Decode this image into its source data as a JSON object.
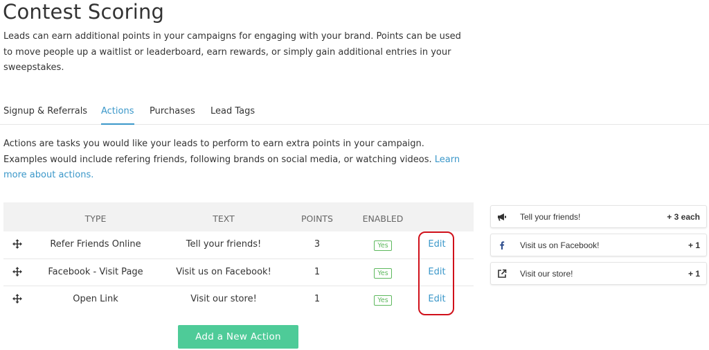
{
  "page": {
    "title": "Contest Scoring",
    "intro": "Leads can earn additional points in your campaigns for engaging with your brand. Points can be used to move people up a waitlist or leaderboard, earn rewards, or simply gain additional entries in your sweepstakes."
  },
  "tabs": [
    {
      "label": "Signup & Referrals",
      "active": false
    },
    {
      "label": "Actions",
      "active": true
    },
    {
      "label": "Purchases",
      "active": false
    },
    {
      "label": "Lead Tags",
      "active": false
    }
  ],
  "actions_description": {
    "text": "Actions are tasks you would like your leads to perform to earn extra points in your campaign. Examples would include refering friends, following brands on social media, or watching videos. ",
    "link": "Learn more about actions."
  },
  "table": {
    "headers": {
      "type": "TYPE",
      "text": "TEXT",
      "points": "POINTS",
      "enabled": "ENABLED"
    },
    "rows": [
      {
        "type": "Refer Friends Online",
        "text": "Tell your friends!",
        "points": "3",
        "enabled": "Yes",
        "edit": "Edit"
      },
      {
        "type": "Facebook - Visit Page",
        "text": "Visit us on Facebook!",
        "points": "1",
        "enabled": "Yes",
        "edit": "Edit"
      },
      {
        "type": "Open Link",
        "text": "Visit our store!",
        "points": "1",
        "enabled": "Yes",
        "edit": "Edit"
      }
    ]
  },
  "add_button": "Add a New Action",
  "preview": [
    {
      "icon": "megaphone-icon",
      "label": "Tell your friends!",
      "points": "+ 3 each"
    },
    {
      "icon": "facebook-icon",
      "label": "Visit us on Facebook!",
      "points": "+ 1"
    },
    {
      "icon": "external-link-icon",
      "label": "Visit our store!",
      "points": "+ 1"
    }
  ],
  "colors": {
    "accent": "#3a97c9",
    "button": "#4ecb98",
    "enabled_badge": "#5cb85c",
    "highlight": "#d0101a"
  }
}
